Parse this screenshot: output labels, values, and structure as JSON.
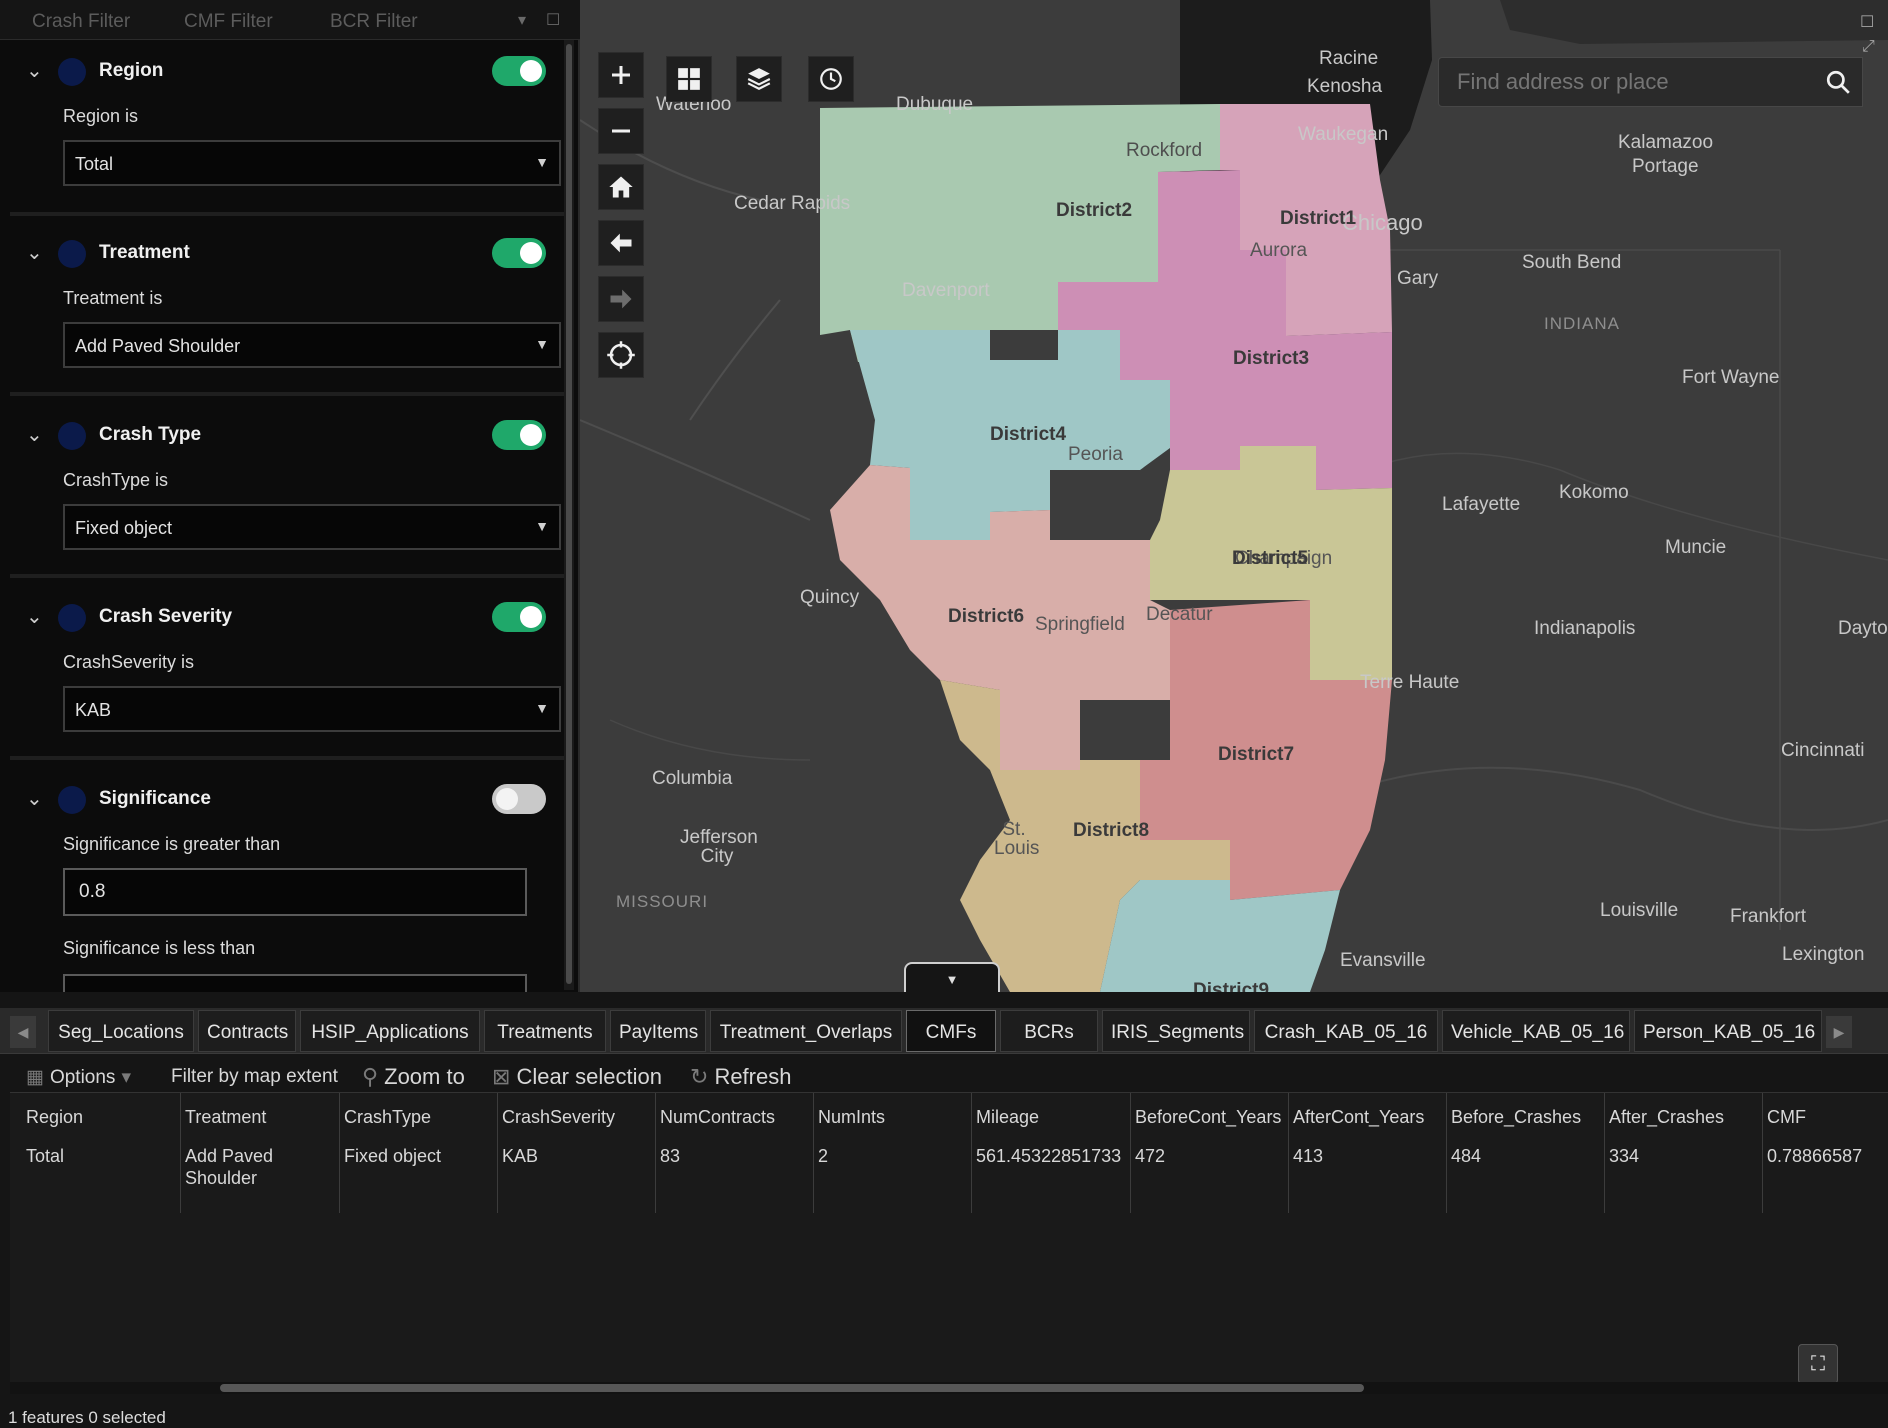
{
  "filter_panel": {
    "tabs": [
      "Crash Filter",
      "CMF Filter",
      "BCR Filter"
    ],
    "filters": [
      {
        "title": "Region",
        "enabled": true,
        "label": "Region is",
        "value": "Total"
      },
      {
        "title": "Treatment",
        "enabled": true,
        "label": "Treatment is",
        "value": "Add Paved Shoulder"
      },
      {
        "title": "Crash Type",
        "enabled": true,
        "label": "CrashType is",
        "value": "Fixed object"
      },
      {
        "title": "Crash Severity",
        "enabled": true,
        "label": "CrashSeverity is",
        "value": "KAB"
      },
      {
        "title": "Significance",
        "enabled": false,
        "label": "Significance is greater than",
        "value": "0.8",
        "label2": "Significance is less than"
      }
    ]
  },
  "map": {
    "search_placeholder": "Find address or place",
    "tools": [
      "zoom-in",
      "zoom-out",
      "home",
      "previous-extent",
      "next-extent",
      "locate"
    ],
    "top_tools": [
      "basemap-gallery",
      "layer-list",
      "time-slider"
    ],
    "districts": [
      "District1",
      "District2",
      "District3",
      "District4",
      "District5",
      "District6",
      "District7",
      "District8",
      "District9"
    ],
    "cities": [
      "Racine",
      "Kenosha",
      "Waterloo",
      "Dubuque",
      "Rockford",
      "Waukegan",
      "Chicago",
      "Cedar Rapids",
      "Aurora",
      "Davenport",
      "Gary",
      "South Bend",
      "Kalamazoo",
      "Portage",
      "INDIANA",
      "Fort Wayne",
      "Peoria",
      "Lafayette",
      "Kokomo",
      "Muncie",
      "Champaign",
      "Quincy",
      "Springfield",
      "Decatur",
      "Indianapolis",
      "Dayton",
      "Terre Haute",
      "Columbia",
      "Cincinnati",
      "Jefferson City",
      "St. Louis",
      "MISSOURI",
      "Louisville",
      "Frankfort",
      "Lexington",
      "Evansville"
    ]
  },
  "table": {
    "tabs": [
      "Seg_Locations",
      "Contracts",
      "HSIP_Applications",
      "Treatments",
      "PayItems",
      "Treatment_Overlaps",
      "CMFs",
      "BCRs",
      "IRIS_Segments",
      "Crash_KAB_05_16",
      "Vehicle_KAB_05_16",
      "Person_KAB_05_16"
    ],
    "active_tab": "CMFs",
    "toolbar": {
      "options": "Options",
      "filter_extent": "Filter by map extent",
      "zoom_to": "Zoom to",
      "clear_selection": "Clear selection",
      "refresh": "Refresh"
    },
    "columns": [
      "Region",
      "Treatment",
      "CrashType",
      "CrashSeverity",
      "NumContracts",
      "NumInts",
      "Mileage",
      "BeforeCont_Years",
      "AfterCont_Years",
      "Before_Crashes",
      "After_Crashes",
      "CMF"
    ],
    "rows": [
      [
        "Total",
        "Add Paved Shoulder",
        "Fixed object",
        "KAB",
        "83",
        "2",
        "561.45322851733",
        "472",
        "413",
        "484",
        "334",
        "0.78866587"
      ]
    ],
    "status": "1 features  0 selected"
  },
  "colors": {
    "toggle_on": "#1fa86a",
    "district_green": "#a9c9b0",
    "district_pink": "#d6a3b9",
    "district_purple": "#cd8fb5",
    "district_teal": "#9fc7c6",
    "district_salmon": "#d8aea9",
    "district_khaki": "#c9c696",
    "district_red": "#cf8e8e",
    "district_tan": "#cdb98d"
  }
}
